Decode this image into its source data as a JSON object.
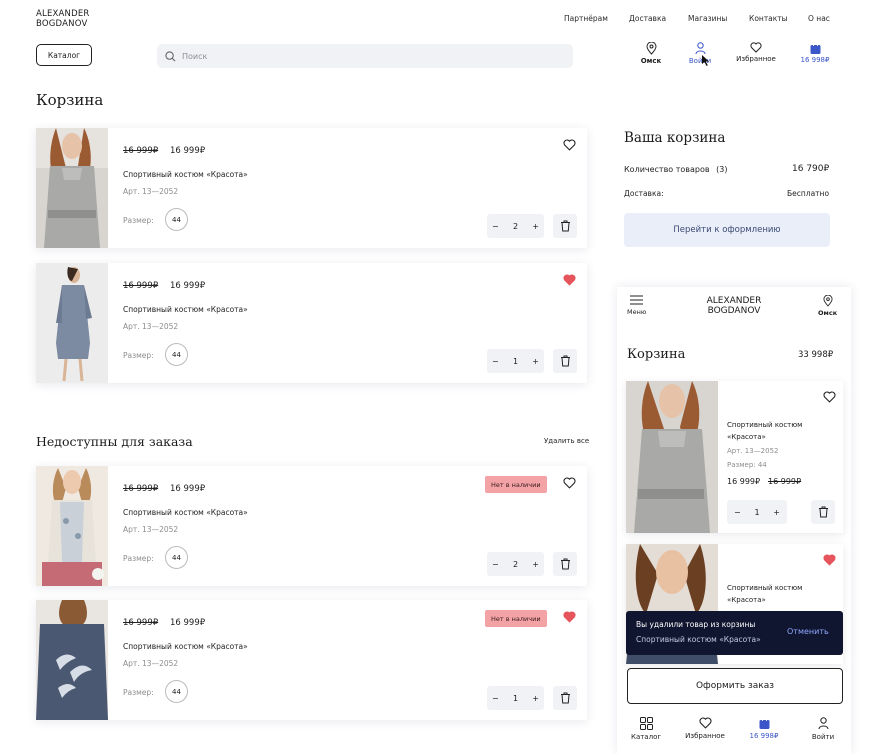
{
  "brand": {
    "line1": "ALEXANDER",
    "line2": "BOGDANOV"
  },
  "nav": [
    "Партнёрам",
    "Доставка",
    "Магазины",
    "Контакты",
    "О нас"
  ],
  "catalog_label": "Каталог",
  "search": {
    "placeholder": "Поиск"
  },
  "header_icons": {
    "city": "Омск",
    "login": "Войти",
    "favorites": "Избранное",
    "cart_total": "16 998₽"
  },
  "page_title": "Корзина",
  "cart_items": [
    {
      "old_price": "16 999₽",
      "price": "16 999₽",
      "name": "Спортивный костюм «Красота»",
      "art": "Арт. 13—2052",
      "size_label": "Размер:",
      "size": "44",
      "qty": "2",
      "favorite": false
    },
    {
      "old_price": "16 999₽",
      "price": "16 999₽",
      "name": "Спортивный костюм «Красота»",
      "art": "Арт. 13—2052",
      "size_label": "Размер:",
      "size": "44",
      "qty": "1",
      "favorite": true
    }
  ],
  "unavailable": {
    "title": "Недоступны для заказа",
    "remove_all": "Удалить все",
    "badge": "Нет в наличии",
    "items": [
      {
        "old_price": "16 999₽",
        "price": "16 999₽",
        "name": "Спортивный костюм «Красота»",
        "art": "Арт. 13—2052",
        "size_label": "Размер:",
        "size": "44",
        "qty": "2",
        "favorite": false
      },
      {
        "old_price": "16 999₽",
        "price": "16 999₽",
        "name": "Спортивный костюм «Красота»",
        "art": "Арт. 13—2052",
        "size_label": "Размер:",
        "size": "44",
        "qty": "1",
        "favorite": true
      }
    ]
  },
  "summary": {
    "title": "Ваша корзина",
    "count_label": "Количество товаров",
    "count": "(3)",
    "count_total": "16 790₽",
    "delivery_label": "Доставка:",
    "delivery_value": "Бесплатно",
    "checkout": "Перейти к оформлению"
  },
  "mobile": {
    "menu": "Меню",
    "logo1": "ALEXANDER",
    "logo2": "BOGDANOV",
    "city": "Омск",
    "title": "Корзина",
    "total": "33 998₽",
    "item1": {
      "name1": "Спортивный костюм",
      "name2": "«Красота»",
      "art": "Арт. 13—2052",
      "size": "Размер: 44",
      "price": "16 999₽",
      "old_price": "16 999₽",
      "qty": "1"
    },
    "item2": {
      "name1": "Спортивный костюм",
      "name2": "«Красота»"
    },
    "toast": {
      "line1": "Вы удалили товар из корзины",
      "line2": "Спортивный костюм «Красота»",
      "action": "Отменить"
    },
    "order": "Оформить заказ",
    "tabs": {
      "catalog": "Каталог",
      "favorites": "Избранное",
      "cart": "16 998₽",
      "login": "Войти"
    }
  },
  "colors": {
    "accent": "#3b56c9",
    "heart": "#e5555b",
    "badge": "#f3a3a6",
    "toast": "#101630"
  }
}
